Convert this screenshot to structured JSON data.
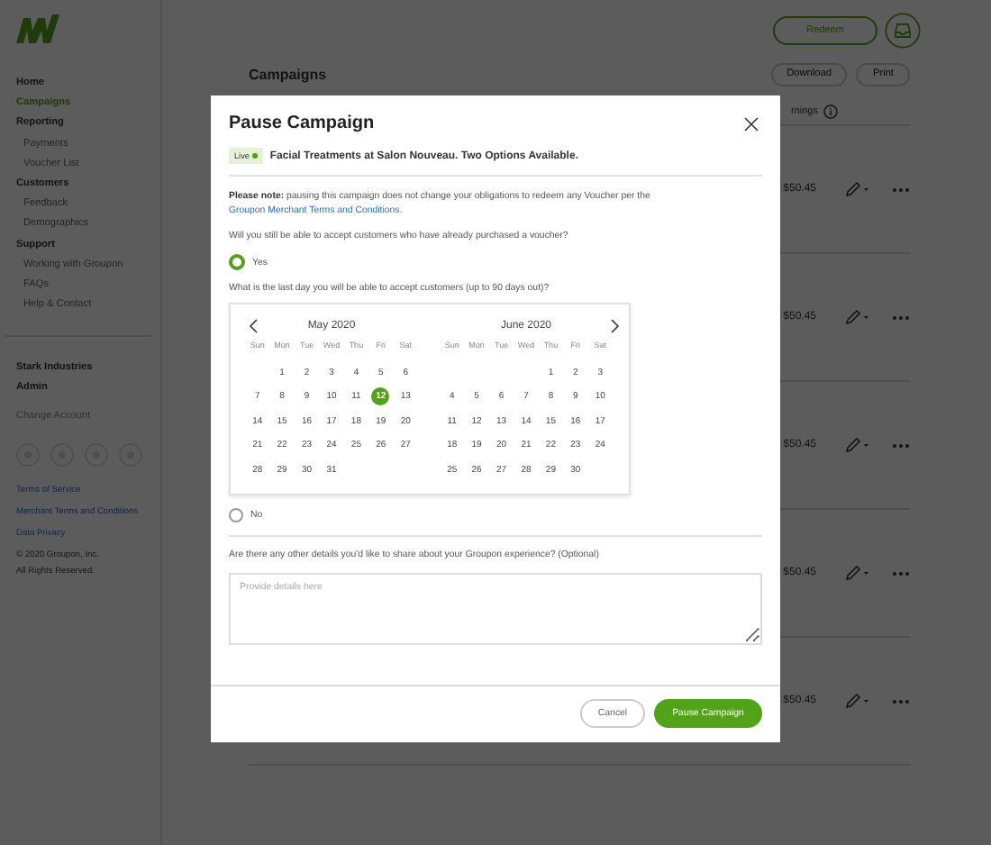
{
  "sidebar": {
    "nav": [
      {
        "label": "Home",
        "selected": false
      },
      {
        "label": "Campaigns",
        "selected": true
      },
      {
        "label": "Reporting",
        "selected": false,
        "children": [
          {
            "label": "Payments",
            "selected": false
          },
          {
            "label": "Voucher List",
            "selected": false
          }
        ]
      },
      {
        "label": "Customers",
        "selected": false,
        "children": [
          {
            "label": "Feedback",
            "selected": false
          },
          {
            "label": "Demographics",
            "selected": false
          }
        ]
      },
      {
        "label": "Support",
        "selected": false,
        "children": [
          {
            "label": "Working with Groupon",
            "selected": false
          },
          {
            "label": "FAQs",
            "selected": false
          },
          {
            "label": "Help & Contact",
            "selected": false
          }
        ]
      }
    ],
    "account": [
      "Stark Industries",
      "Admin"
    ],
    "change_account": "Change Account",
    "links": [
      "Terms of Service",
      "Merchant Terms and Conditions",
      "Data Privacy"
    ],
    "copyright": [
      "© 2020 Groupon, Inc.",
      "All Rights Reserved."
    ]
  },
  "topbar": {
    "redeem_button": "Redeem"
  },
  "main": {
    "title": "Campaigns",
    "actions": [
      "Download",
      "Print"
    ],
    "table": {
      "columns": [
        "rnings"
      ],
      "rows": [
        {
          "earnings": "$50.45"
        },
        {
          "earnings": "$50.45"
        },
        {
          "earnings": "$50.45"
        },
        {
          "earnings": "$50.45"
        },
        {
          "earnings": "$50.45"
        }
      ]
    }
  },
  "modal": {
    "title": "Pause Campaign",
    "status_badge": "Live",
    "campaign_name": "Facial Treatments at Salon Nouveau. Two Options Available.",
    "note": {
      "label": "Please note:",
      "text": "pausing this campaign does not change your obligations to redeem any Voucher per the",
      "link": "Groupon Merchant Terms and Conditions."
    },
    "question": "Will you still be able to accept customers who have already purchased a voucher?",
    "options": [
      {
        "label": "Yes",
        "selected": true
      },
      {
        "label": "No",
        "selected": false
      }
    ],
    "date_question": "What is the last day you will be able to accept customers (up to 90 days out)?",
    "calendar": {
      "months": [
        {
          "title": "May 2020",
          "weekdays": [
            "Sun",
            "Mon",
            "Tue",
            "Wed",
            "Thu",
            "Fri",
            "Sat"
          ],
          "weeks": [
            [
              {
                "kind": "blank"
              },
              {
                "kind": "day",
                "d": "1",
                "selected": false
              },
              {
                "kind": "day",
                "d": "2",
                "selected": false
              },
              {
                "kind": "day",
                "d": "3",
                "selected": false
              },
              {
                "kind": "day",
                "d": "4",
                "selected": false
              },
              {
                "kind": "day",
                "d": "5",
                "selected": false
              },
              {
                "kind": "day",
                "d": "6",
                "selected": false
              }
            ],
            [
              {
                "kind": "day",
                "d": "7",
                "selected": false
              },
              {
                "kind": "day",
                "d": "8",
                "selected": false
              },
              {
                "kind": "day",
                "d": "9",
                "selected": false
              },
              {
                "kind": "day",
                "d": "10",
                "selected": false
              },
              {
                "kind": "day",
                "d": "11",
                "selected": false
              },
              {
                "kind": "day",
                "d": "12",
                "selected": true
              },
              {
                "kind": "day",
                "d": "13",
                "selected": false
              }
            ],
            [
              {
                "kind": "day",
                "d": "14",
                "selected": false
              },
              {
                "kind": "day",
                "d": "15",
                "selected": false
              },
              {
                "kind": "day",
                "d": "16",
                "selected": false
              },
              {
                "kind": "day",
                "d": "17",
                "selected": false
              },
              {
                "kind": "day",
                "d": "18",
                "selected": false
              },
              {
                "kind": "day",
                "d": "19",
                "selected": false
              },
              {
                "kind": "day",
                "d": "20",
                "selected": false
              }
            ],
            [
              {
                "kind": "day",
                "d": "21",
                "selected": false
              },
              {
                "kind": "day",
                "d": "22",
                "selected": false
              },
              {
                "kind": "day",
                "d": "23",
                "selected": false
              },
              {
                "kind": "day",
                "d": "24",
                "selected": false
              },
              {
                "kind": "day",
                "d": "25",
                "selected": false
              },
              {
                "kind": "day",
                "d": "26",
                "selected": false
              },
              {
                "kind": "day",
                "d": "27",
                "selected": false
              }
            ],
            [
              {
                "kind": "day",
                "d": "28",
                "selected": false
              },
              {
                "kind": "day",
                "d": "29",
                "selected": false
              },
              {
                "kind": "day",
                "d": "30",
                "selected": false
              },
              {
                "kind": "day",
                "d": "31",
                "selected": false
              }
            ]
          ]
        },
        {
          "title": "June 2020",
          "weekdays": [
            "Sun",
            "Mon",
            "Tue",
            "Wed",
            "Thu",
            "Fri",
            "Sat"
          ],
          "weeks": [
            [
              {
                "kind": "blank"
              },
              {
                "kind": "blank"
              },
              {
                "kind": "blank"
              },
              {
                "kind": "blank"
              },
              {
                "kind": "day",
                "d": "1",
                "selected": false
              },
              {
                "kind": "day",
                "d": "2",
                "selected": false
              },
              {
                "kind": "day",
                "d": "3",
                "selected": false
              }
            ],
            [
              {
                "kind": "day",
                "d": "4",
                "selected": false
              },
              {
                "kind": "day",
                "d": "5",
                "selected": false
              },
              {
                "kind": "day",
                "d": "6",
                "selected": false
              },
              {
                "kind": "day",
                "d": "7",
                "selected": false
              },
              {
                "kind": "day",
                "d": "8",
                "selected": false
              },
              {
                "kind": "day",
                "d": "9",
                "selected": false
              },
              {
                "kind": "day",
                "d": "10",
                "selected": false
              }
            ],
            [
              {
                "kind": "day",
                "d": "11",
                "selected": false
              },
              {
                "kind": "day",
                "d": "12",
                "selected": false
              },
              {
                "kind": "day",
                "d": "13",
                "selected": false
              },
              {
                "kind": "day",
                "d": "14",
                "selected": false
              },
              {
                "kind": "day",
                "d": "15",
                "selected": false
              },
              {
                "kind": "day",
                "d": "16",
                "selected": false
              },
              {
                "kind": "day",
                "d": "17",
                "selected": false
              }
            ],
            [
              {
                "kind": "day",
                "d": "18",
                "selected": false
              },
              {
                "kind": "day",
                "d": "19",
                "selected": false
              },
              {
                "kind": "day",
                "d": "20",
                "selected": false
              },
              {
                "kind": "day",
                "d": "21",
                "selected": false
              },
              {
                "kind": "day",
                "d": "22",
                "selected": false
              },
              {
                "kind": "day",
                "d": "23",
                "selected": false
              },
              {
                "kind": "day",
                "d": "24",
                "selected": false
              }
            ],
            [
              {
                "kind": "day",
                "d": "25",
                "selected": false
              },
              {
                "kind": "day",
                "d": "26",
                "selected": false
              },
              {
                "kind": "day",
                "d": "27",
                "selected": false
              },
              {
                "kind": "day",
                "d": "28",
                "selected": false
              },
              {
                "kind": "day",
                "d": "29",
                "selected": false
              },
              {
                "kind": "day",
                "d": "30",
                "selected": false
              }
            ]
          ]
        }
      ]
    },
    "details_question": "Are there any other details you'd like to share about your Groupon experience? (Optional)",
    "details_placeholder": "Provide details here",
    "buttons": {
      "cancel": "Cancel",
      "confirm": "Pause Campaign"
    }
  }
}
